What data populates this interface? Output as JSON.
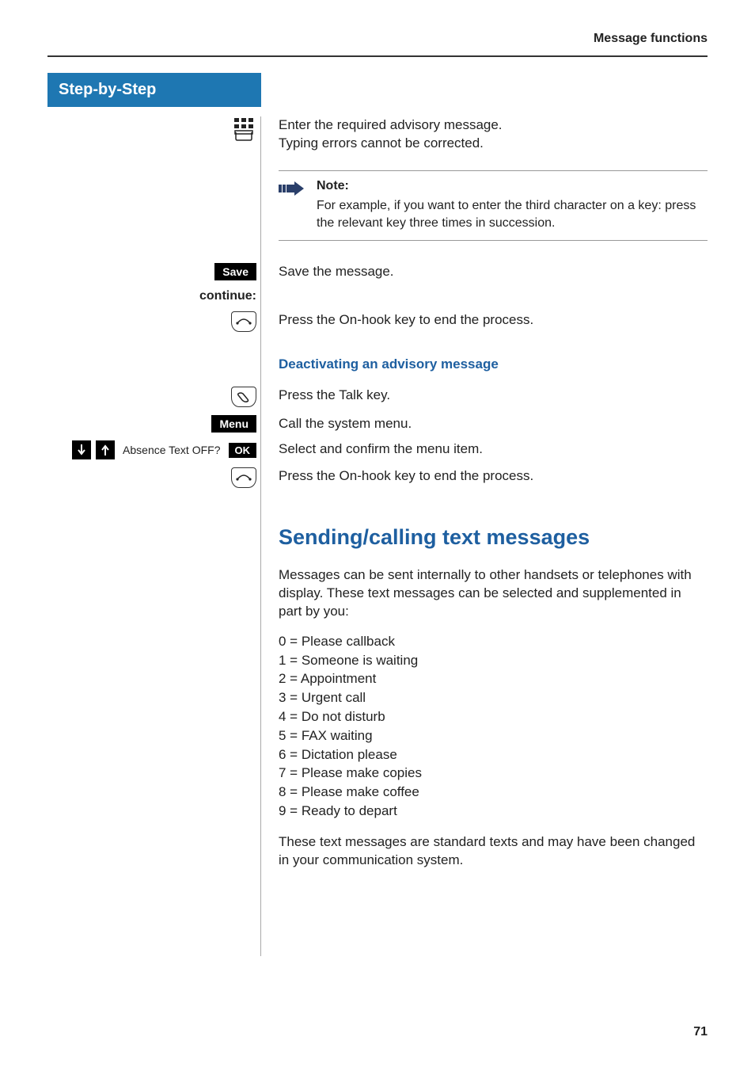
{
  "header": {
    "section_title": "Message functions"
  },
  "sidebar": {
    "title": "Step-by-Step"
  },
  "steps": {
    "enter_text": {
      "line1": "Enter the required advisory message.",
      "line2": "Typing errors cannot be corrected."
    },
    "note": {
      "title": "Note:",
      "body": "For example, if you want to enter the third character on a key: press the relevant key three times in succession."
    },
    "save": {
      "btn": "Save",
      "text": "Save the message."
    },
    "continue_label": "continue:",
    "onhook1": "Press the On-hook key to end the process.",
    "deactivate_heading": "Deactivating an advisory message",
    "talk": "Press the Talk key.",
    "menu": {
      "btn": "Menu",
      "text": "Call the system menu."
    },
    "select": {
      "display": "Absence Text OFF?",
      "ok": "OK",
      "text": "Select and confirm the menu item."
    },
    "onhook2": "Press the On-hook key to end the process."
  },
  "section2": {
    "heading": "Sending/calling text messages",
    "intro": "Messages can be sent internally to other handsets or telephones with display. These text messages can be selected and supplemented in part by you:",
    "list": [
      "0 = Please callback",
      "1 = Someone is waiting",
      "2 = Appointment",
      "3 = Urgent call",
      "4 = Do not disturb",
      "5 = FAX waiting",
      "6 = Dictation please",
      "7 = Please make copies",
      "8 = Please make coffee",
      "9 = Ready to depart"
    ],
    "outro": "These text messages are standard texts and may have been changed in your communication system."
  },
  "page_number": "71"
}
